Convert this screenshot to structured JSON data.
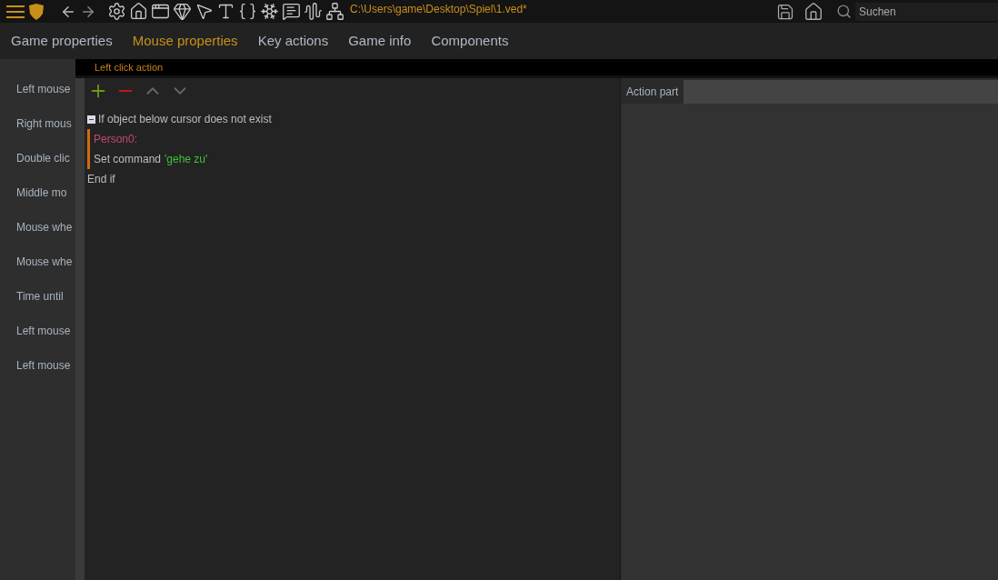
{
  "toolbar": {
    "path": "C:\\Users\\game\\Desktop\\Spiel\\1.ved*"
  },
  "search": {
    "placeholder": "Suchen"
  },
  "tabs": [
    {
      "label": "Game properties",
      "selected": false
    },
    {
      "label": "Mouse properties",
      "selected": true
    },
    {
      "label": "Key actions",
      "selected": false
    },
    {
      "label": "Game info",
      "selected": false
    },
    {
      "label": "Components",
      "selected": false
    }
  ],
  "properties": [
    "Left mouse",
    "Right mous",
    "Double clic",
    "Middle mo",
    "Mouse whe",
    "Mouse whe",
    "Time until",
    "Left mouse",
    "Left mouse"
  ],
  "dialog": {
    "title": "Left click action",
    "script": [
      {
        "kind": "block",
        "text": "If object below cursor does not exist",
        "expanded": true,
        "children": [
          {
            "kind": "object",
            "text": "Person0:"
          },
          {
            "kind": "command",
            "text": "Set command",
            "argument": "'gehe zu'"
          }
        ]
      },
      {
        "kind": "end",
        "text": "End if"
      }
    ],
    "action_part": {
      "label": "Action part"
    }
  }
}
